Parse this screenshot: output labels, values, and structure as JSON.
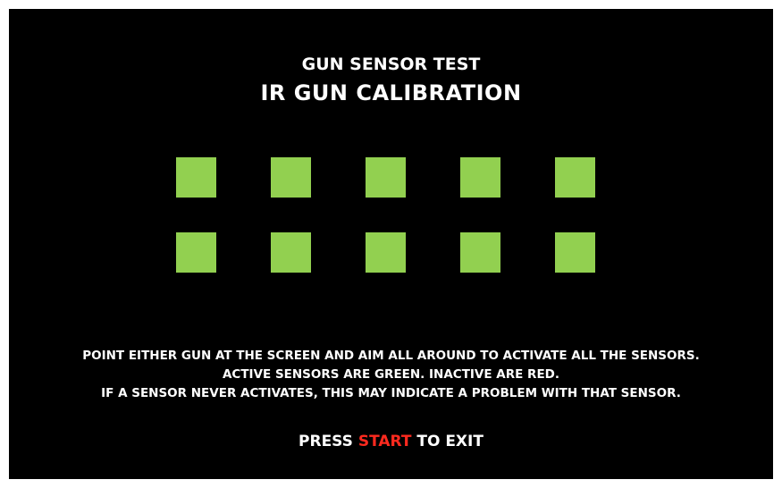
{
  "header": {
    "subtitle": "GUN SENSOR TEST",
    "title": "IR GUN CALIBRATION"
  },
  "sensors": {
    "count": 10,
    "states": [
      "active",
      "active",
      "active",
      "active",
      "active",
      "active",
      "active",
      "active",
      "active",
      "active"
    ],
    "colors": {
      "active": "#92d050",
      "inactive": "#ff0000"
    }
  },
  "instructions": {
    "line1": "POINT EITHER GUN AT THE SCREEN AND AIM ALL AROUND TO ACTIVATE ALL THE SENSORS.",
    "line2": "ACTIVE SENSORS ARE GREEN. INACTIVE ARE RED.",
    "line3": "IF A SENSOR NEVER ACTIVATES, THIS MAY INDICATE A PROBLEM WITH THAT SENSOR."
  },
  "exit_prompt": {
    "before": "PRESS ",
    "key": "START",
    "after": " TO EXIT",
    "key_color": "#ff2a1f"
  }
}
